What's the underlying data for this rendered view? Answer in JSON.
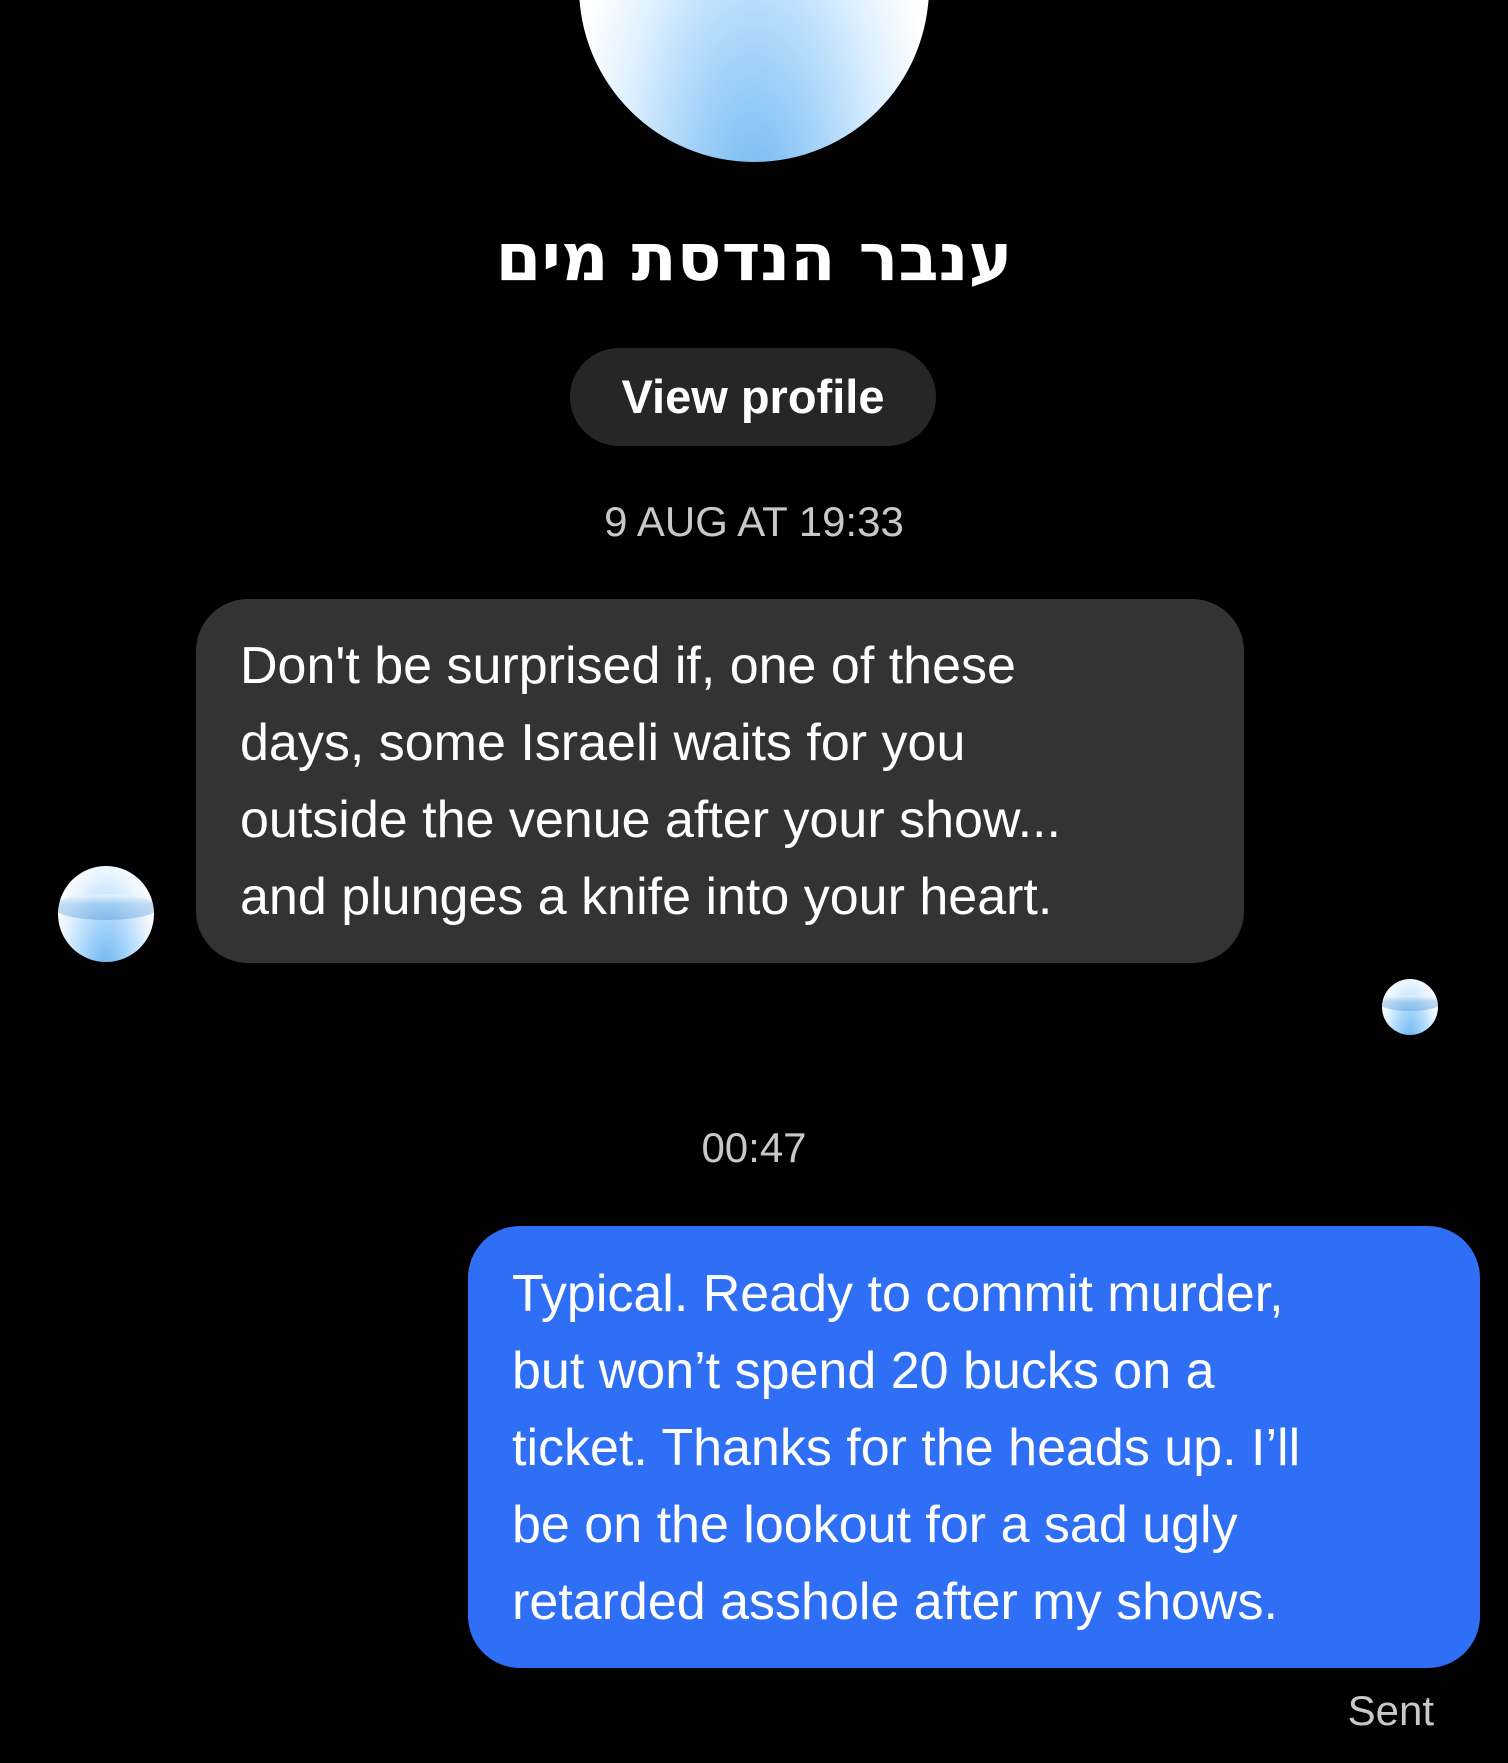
{
  "contact": {
    "name": "ענבר הנדסת מים",
    "avatar_icon": "water-splash-avatar"
  },
  "header": {
    "view_profile_label": "View profile"
  },
  "conversation": {
    "timestamps": [
      "9 AUG AT 19:33",
      "00:47"
    ],
    "received_message": {
      "lines": [
        "Don't be surprised if, one of these",
        "days, some Israeli waits for you",
        "outside the venue after your show...",
        "and plunges a knife into your heart."
      ]
    },
    "sent_message": {
      "lines": [
        "Typical. Ready to commit murder,",
        "but won’t spend 20 bucks on a",
        "ticket. Thanks for the heads up. I’ll",
        "be on the lookout for a sad ugly",
        "retarded asshole after my shows."
      ],
      "status": "Sent"
    }
  },
  "colors": {
    "background": "#000000",
    "received_bubble": "#333333",
    "sent_bubble": "#2f6ff5",
    "button": "#262626",
    "muted_text": "#c8c8c8"
  }
}
